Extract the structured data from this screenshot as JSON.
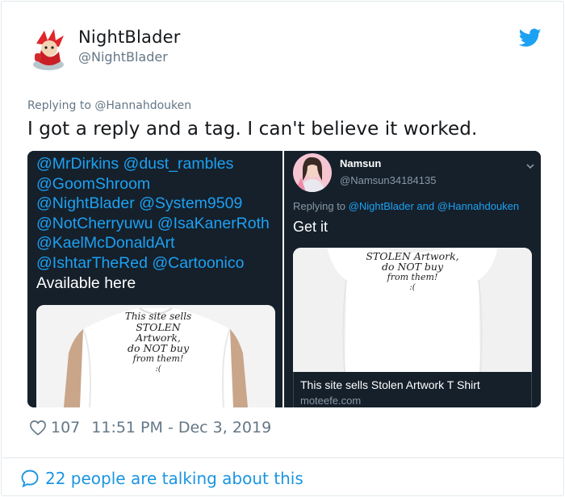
{
  "tweet": {
    "display_name": "NightBlader",
    "handle": "@NightBlader",
    "replying_prefix": "Replying to",
    "replying_to": "@Hannahdouken",
    "text": "I got a reply and a tag. I can't believe it worked.",
    "likes": "107",
    "timestamp": "11:51 PM - Dec 3, 2019",
    "talking": "22 people are talking about this"
  },
  "left_screenshot": {
    "mention_lines": [
      "@MrDirkins @dust_rambles",
      "@GoomShroom",
      "@NightBlader @System9509",
      "@NotCherryuwu @IsaKanerRoth",
      "@KaelMcDonaldArt",
      "@IshtarTheRed @Cartoonico"
    ],
    "available": "Available here",
    "shirt_lines": [
      "This site sells",
      "STOLEN Artwork,",
      "do NOT buy",
      "from them!",
      ":("
    ]
  },
  "right_screenshot": {
    "name": "Namsun",
    "handle": "@Namsun34184135",
    "replying_prefix": "Replying to",
    "replying_mention1": "@NightBlader",
    "replying_and": "and",
    "replying_mention2": "@Hannahdouken",
    "text": "Get it",
    "card_title": "This site sells Stolen Artwork T Shirt",
    "card_domain": "moteefe.com",
    "shirt_lines": [
      "STOLEN Artwork,",
      "do NOT buy",
      "from them!",
      ":("
    ]
  },
  "colors": {
    "twitter_blue": "#1da1f2",
    "dark_bg": "#15202b",
    "muted": "#657786"
  },
  "icons": [
    "twitter-bird-icon",
    "heart-icon",
    "speech-bubble-icon",
    "chevron-down-icon"
  ]
}
